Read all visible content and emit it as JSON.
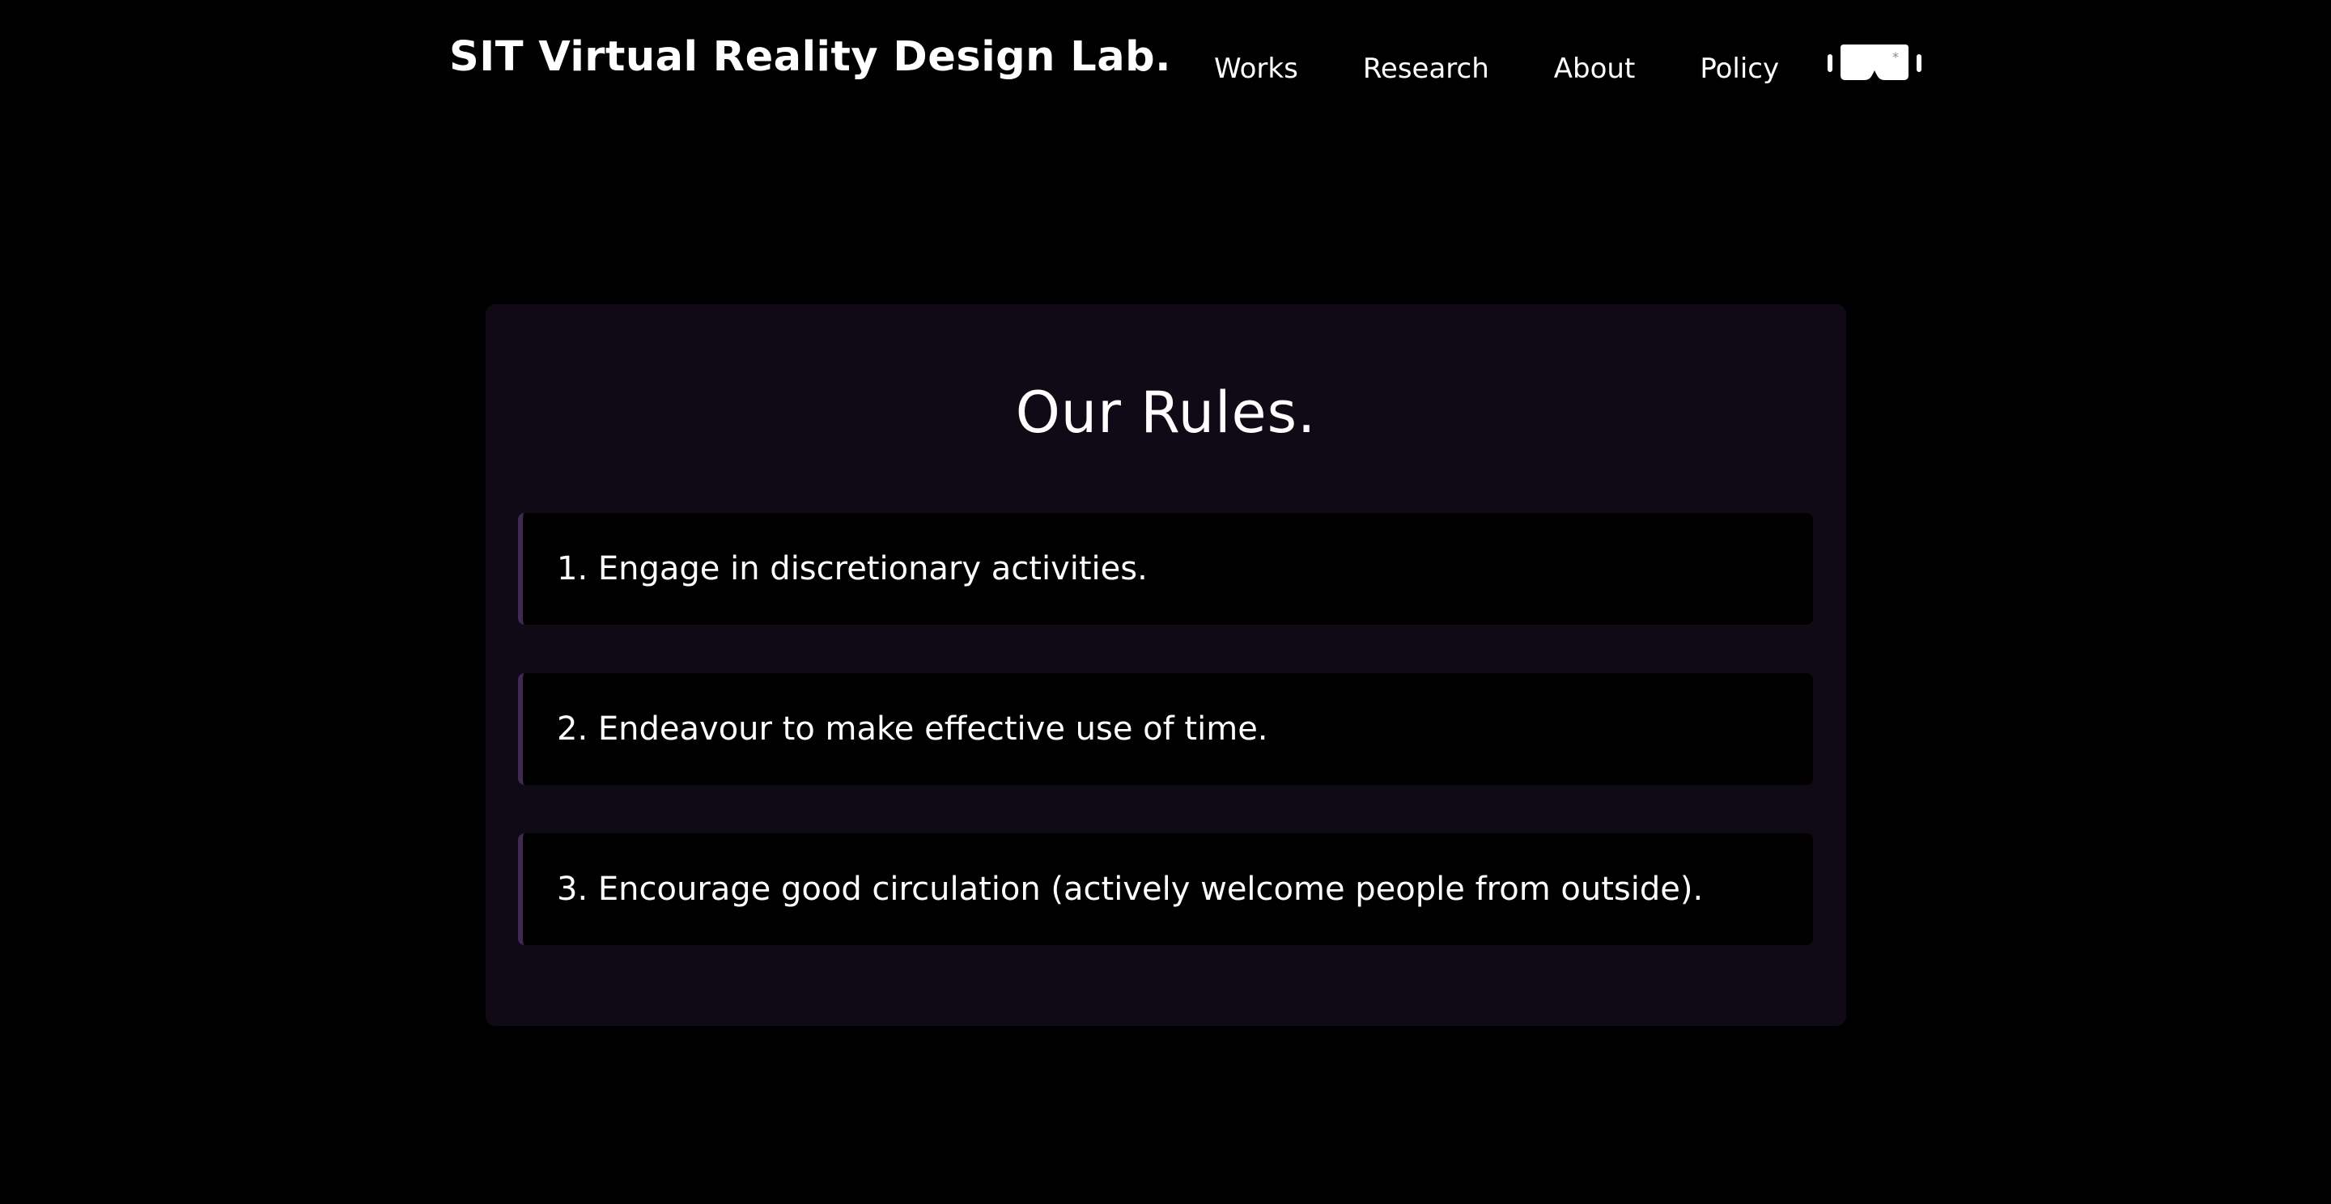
{
  "header": {
    "site_title": "SIT Virtual Reality Design Lab.",
    "nav": [
      {
        "label": "Works"
      },
      {
        "label": "Research"
      },
      {
        "label": "About"
      },
      {
        "label": "Policy"
      }
    ],
    "logo_icon": "vr-headset-icon"
  },
  "main": {
    "title": "Our Rules.",
    "rules": [
      {
        "text": "1. Engage in discretionary activities."
      },
      {
        "text": "2. Endeavour to make effective use of time."
      },
      {
        "text": "3. Encourage good circulation (actively welcome people from outside)."
      }
    ]
  },
  "colors": {
    "background": "#000000",
    "card": "#100a16",
    "accent_border": "#3e2a52",
    "text": "#ffffff"
  }
}
